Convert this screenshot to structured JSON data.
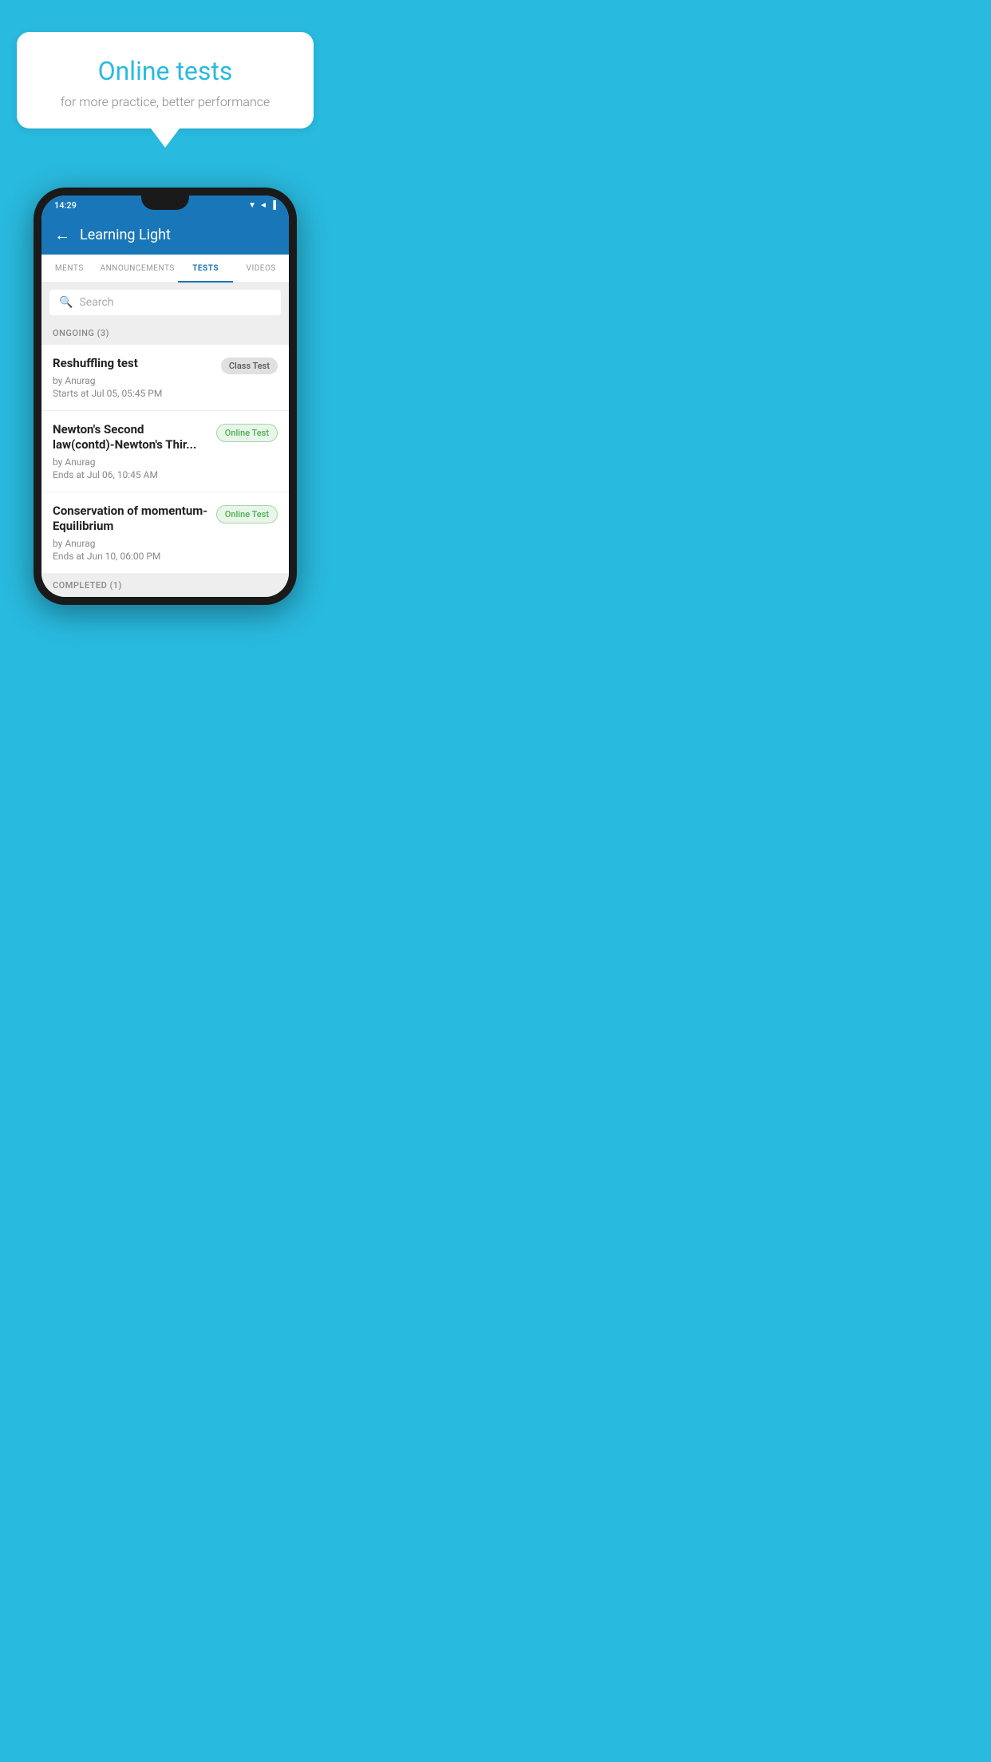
{
  "background_color": "#29BADF",
  "bubble": {
    "title": "Online tests",
    "subtitle": "for more practice, better performance"
  },
  "phone": {
    "status_bar": {
      "time": "14:29",
      "icons": "▼ ◄ ▐"
    },
    "app_header": {
      "title": "Learning Light",
      "back_label": "←"
    },
    "tabs": [
      {
        "label": "MENTS",
        "active": false
      },
      {
        "label": "ANNOUNCEMENTS",
        "active": false
      },
      {
        "label": "TESTS",
        "active": true
      },
      {
        "label": "VIDEOS",
        "active": false
      }
    ],
    "search": {
      "placeholder": "Search"
    },
    "section_ongoing": {
      "label": "ONGOING (3)"
    },
    "tests": [
      {
        "name": "Reshuffling test",
        "author": "by Anurag",
        "time_label": "Starts at",
        "time": "Jul 05, 05:45 PM",
        "badge": "Class Test",
        "badge_type": "class"
      },
      {
        "name": "Newton's Second law(contd)-Newton's Thir...",
        "author": "by Anurag",
        "time_label": "Ends at",
        "time": "Jul 06, 10:45 AM",
        "badge": "Online Test",
        "badge_type": "online"
      },
      {
        "name": "Conservation of momentum-Equilibrium",
        "author": "by Anurag",
        "time_label": "Ends at",
        "time": "Jun 10, 06:00 PM",
        "badge": "Online Test",
        "badge_type": "online"
      }
    ],
    "section_completed": {
      "label": "COMPLETED (1)"
    }
  }
}
